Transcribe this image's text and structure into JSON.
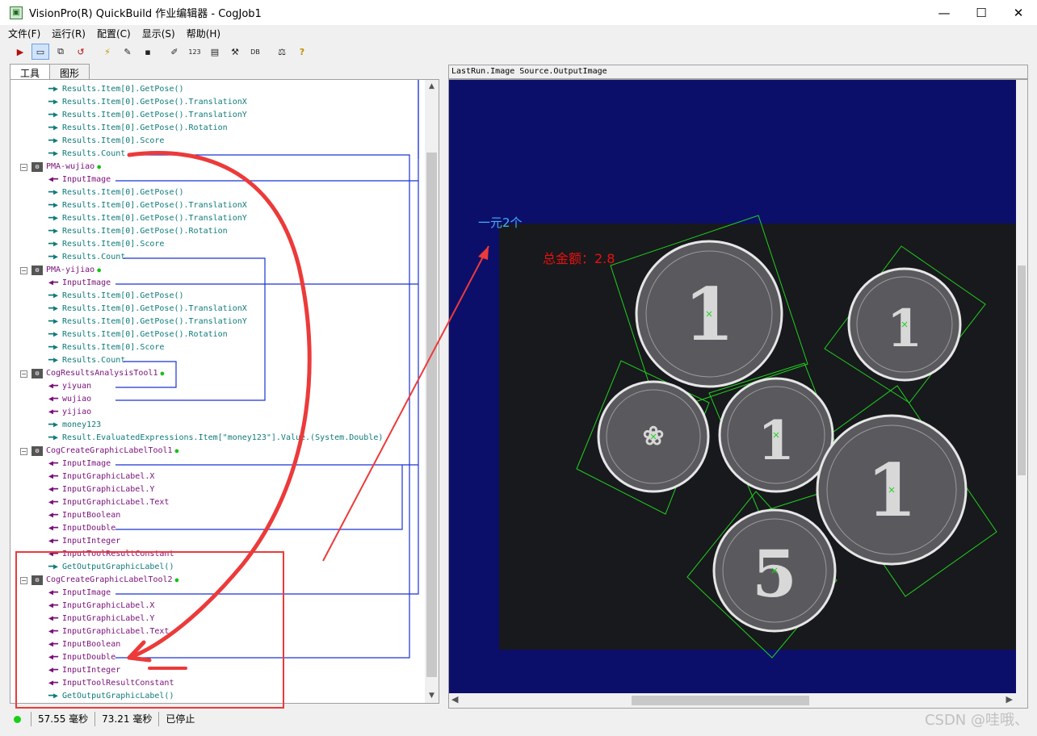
{
  "window": {
    "title": "VisionPro(R) QuickBuild 作业编辑器 - CogJob1",
    "icon": "app-icon"
  },
  "window_controls": {
    "minimize": "—",
    "maximize": "☐",
    "close": "✕"
  },
  "menu": [
    "文件(F)",
    "运行(R)",
    "配置(C)",
    "显示(S)",
    "帮助(H)"
  ],
  "toolbar": {
    "buttons": [
      "▶",
      "▭",
      "⧉",
      "↺",
      "⚡",
      "✎",
      "▪",
      "✐",
      "123",
      "▤",
      "⚒",
      "DB",
      "⚖",
      "?"
    ]
  },
  "left_tabs": [
    "工具",
    "图形"
  ],
  "tree": {
    "groups": [
      {
        "header": null,
        "rows": [
          {
            "dir": "out",
            "text": "Results.Item[0].GetPose()"
          },
          {
            "dir": "out",
            "text": "Results.Item[0].GetPose().TranslationX"
          },
          {
            "dir": "out",
            "text": "Results.Item[0].GetPose().TranslationY"
          },
          {
            "dir": "out",
            "text": "Results.Item[0].GetPose().Rotation"
          },
          {
            "dir": "out",
            "text": "Results.Item[0].Score"
          },
          {
            "dir": "out",
            "text": "Results.Count"
          }
        ]
      },
      {
        "header": "PMA-wujiao",
        "rows": [
          {
            "dir": "in",
            "text": "InputImage"
          },
          {
            "dir": "out",
            "text": "Results.Item[0].GetPose()"
          },
          {
            "dir": "out",
            "text": "Results.Item[0].GetPose().TranslationX"
          },
          {
            "dir": "out",
            "text": "Results.Item[0].GetPose().TranslationY"
          },
          {
            "dir": "out",
            "text": "Results.Item[0].GetPose().Rotation"
          },
          {
            "dir": "out",
            "text": "Results.Item[0].Score"
          },
          {
            "dir": "out",
            "text": "Results.Count"
          }
        ]
      },
      {
        "header": "PMA-yijiao",
        "rows": [
          {
            "dir": "in",
            "text": "InputImage"
          },
          {
            "dir": "out",
            "text": "Results.Item[0].GetPose()"
          },
          {
            "dir": "out",
            "text": "Results.Item[0].GetPose().TranslationX"
          },
          {
            "dir": "out",
            "text": "Results.Item[0].GetPose().TranslationY"
          },
          {
            "dir": "out",
            "text": "Results.Item[0].GetPose().Rotation"
          },
          {
            "dir": "out",
            "text": "Results.Item[0].Score"
          },
          {
            "dir": "out",
            "text": "Results.Count"
          }
        ]
      },
      {
        "header": "CogResultsAnalysisTool1",
        "rows": [
          {
            "dir": "in",
            "text": "yiyuan"
          },
          {
            "dir": "in",
            "text": "wujiao"
          },
          {
            "dir": "in",
            "text": "yijiao"
          },
          {
            "dir": "out",
            "text": "money123"
          },
          {
            "dir": "out",
            "text": "Result.EvaluatedExpressions.Item[\"money123\"].Value.(System.Double)"
          }
        ]
      },
      {
        "header": "CogCreateGraphicLabelTool1",
        "rows": [
          {
            "dir": "in",
            "text": "InputImage"
          },
          {
            "dir": "in",
            "text": "InputGraphicLabel.X"
          },
          {
            "dir": "in",
            "text": "InputGraphicLabel.Y"
          },
          {
            "dir": "in",
            "text": "InputGraphicLabel.Text"
          },
          {
            "dir": "in",
            "text": "InputBoolean"
          },
          {
            "dir": "in",
            "text": "InputDouble"
          },
          {
            "dir": "in",
            "text": "InputInteger"
          },
          {
            "dir": "in",
            "text": "InputToolResultConstant"
          },
          {
            "dir": "out",
            "text": "GetOutputGraphicLabel()"
          }
        ]
      },
      {
        "header": "CogCreateGraphicLabelTool2",
        "rows": [
          {
            "dir": "in",
            "text": "InputImage"
          },
          {
            "dir": "in",
            "text": "InputGraphicLabel.X"
          },
          {
            "dir": "in",
            "text": "InputGraphicLabel.Y"
          },
          {
            "dir": "in",
            "text": "InputGraphicLabel.Text"
          },
          {
            "dir": "in",
            "text": "InputBoolean"
          },
          {
            "dir": "in",
            "text": "InputDouble"
          },
          {
            "dir": "in",
            "text": "InputInteger"
          },
          {
            "dir": "in",
            "text": "InputToolResultConstant"
          },
          {
            "dir": "out",
            "text": "GetOutputGraphicLabel()"
          }
        ]
      }
    ]
  },
  "image_panel": {
    "header": "LastRun.Image Source.OutputImage",
    "label_count": "一元2个",
    "label_total": "总金额：2.8",
    "colors": {
      "background": "#0c0f6a",
      "label_count": "#40b0ff",
      "label_total": "#e81010",
      "box": "#20d020"
    }
  },
  "status": {
    "time1": "57.55 毫秒",
    "time2": "73.21 毫秒",
    "state": "已停止"
  },
  "watermark": "CSDN @哇哦、"
}
